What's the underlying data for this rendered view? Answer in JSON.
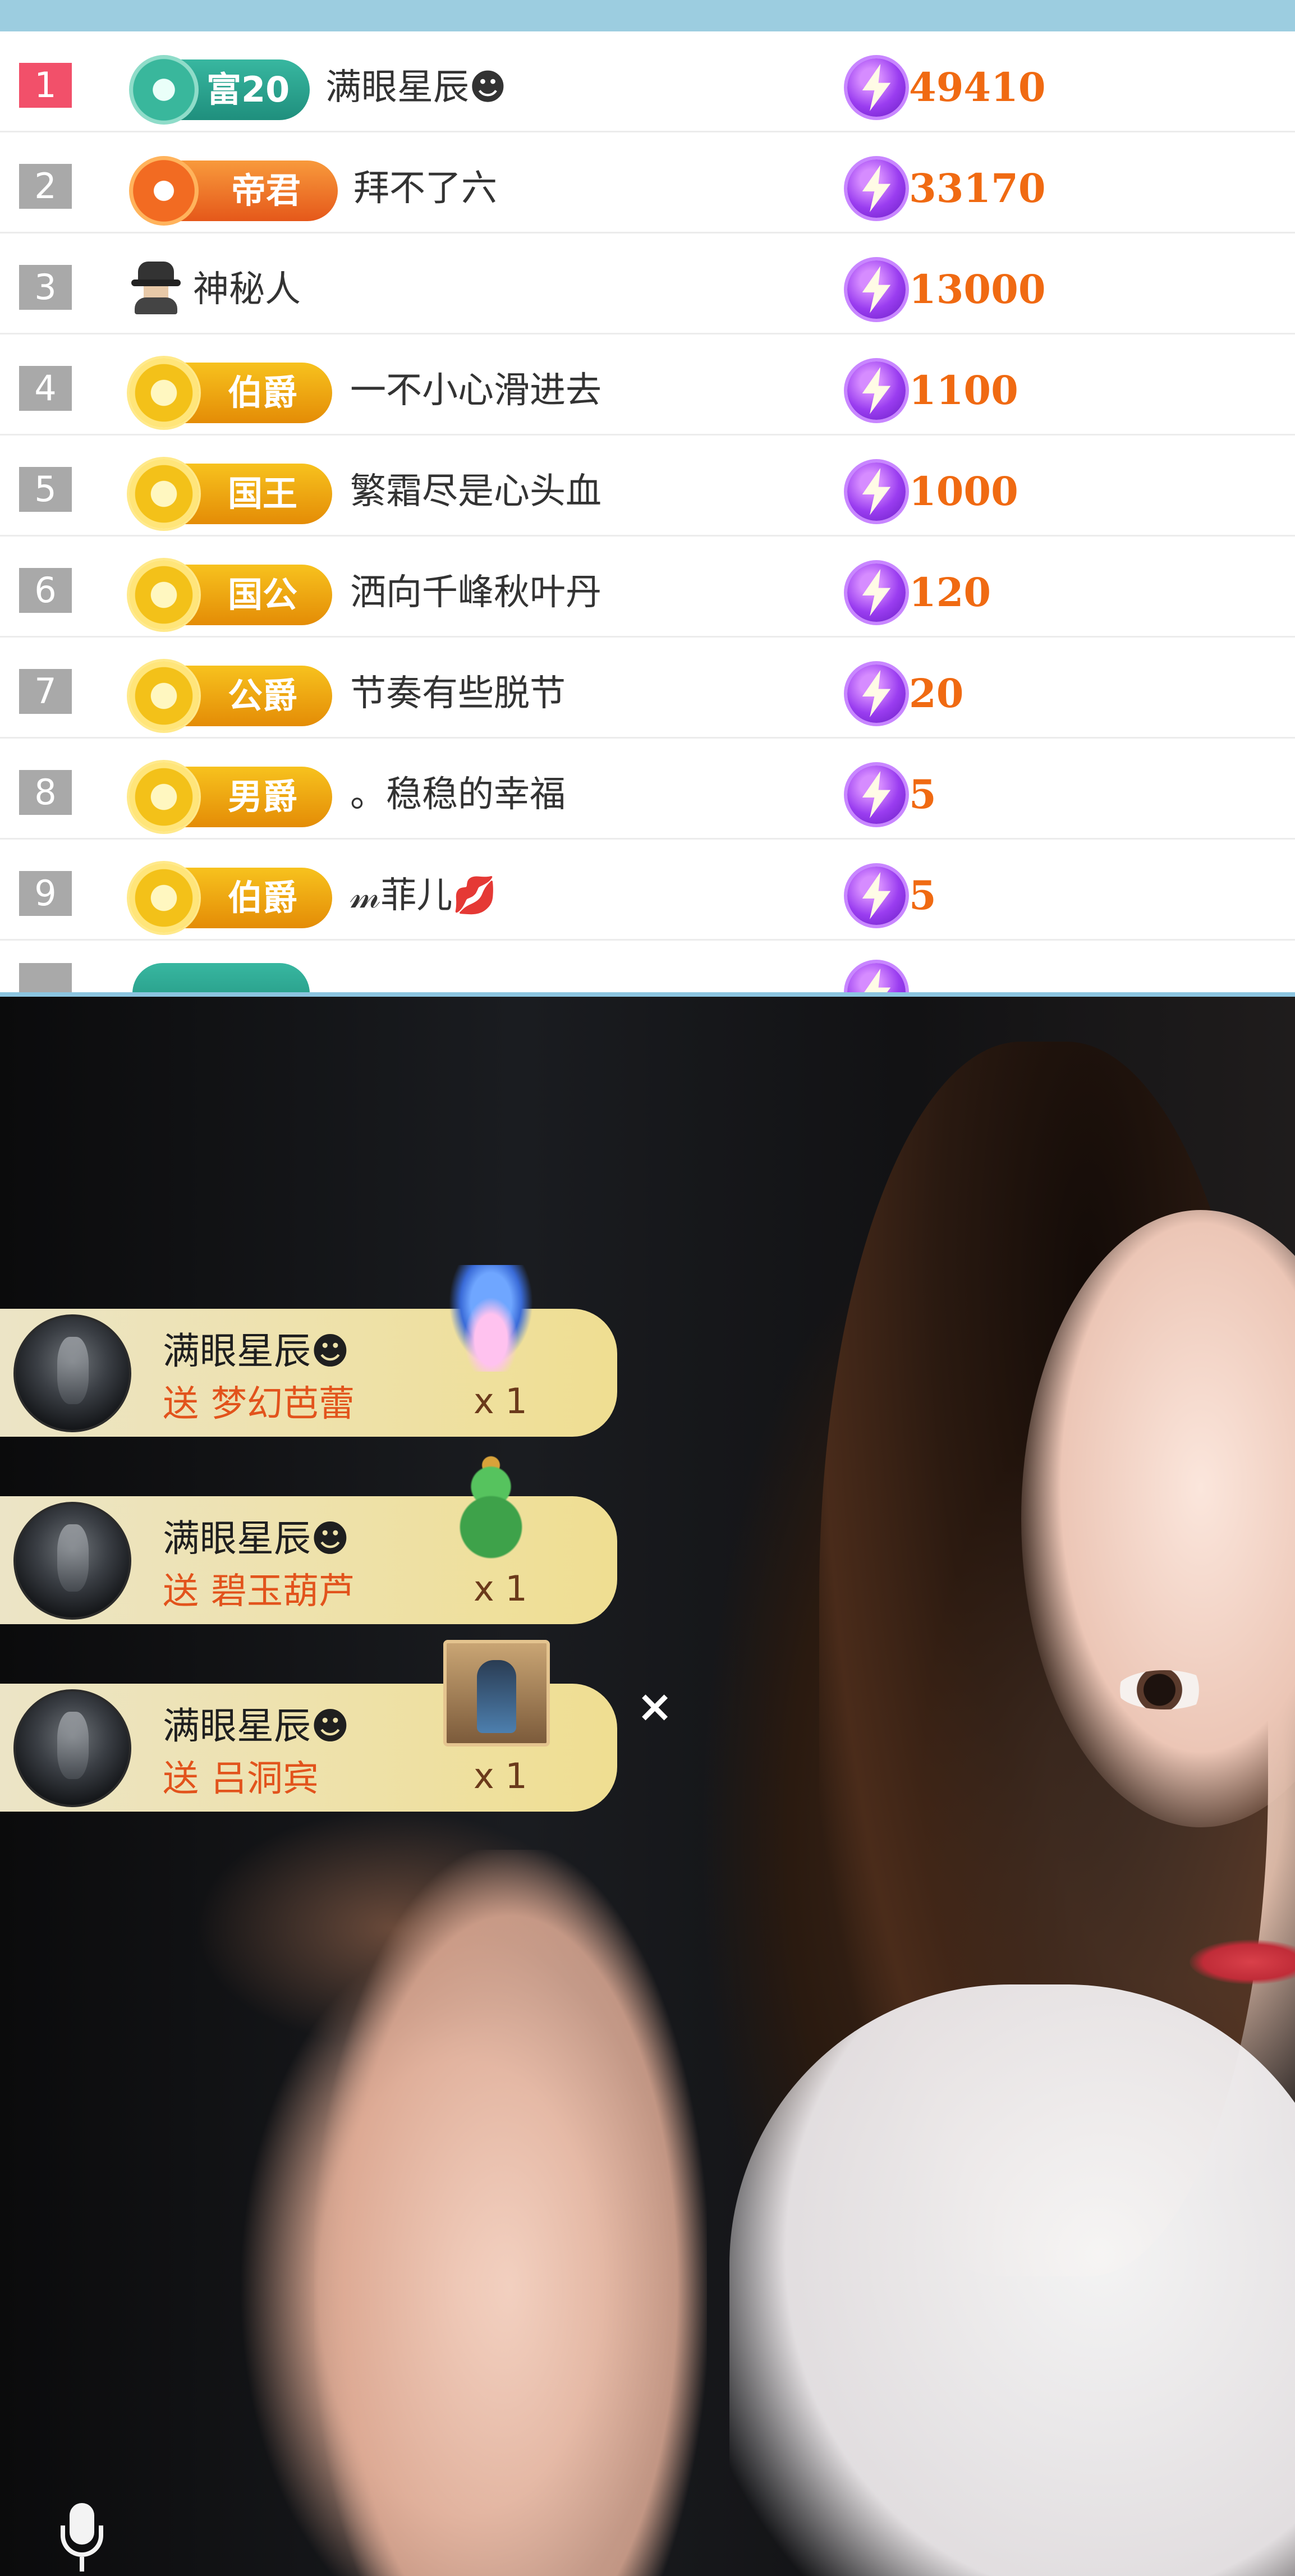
{
  "ranking": [
    {
      "rank": "1",
      "badge": "富20",
      "badge_style": "teal",
      "name": "满眼星辰☻",
      "value": "49410"
    },
    {
      "rank": "2",
      "badge": "帝君",
      "badge_style": "orange",
      "name": "拜不了六",
      "value": "33170"
    },
    {
      "rank": "3",
      "badge": "",
      "badge_style": "mystery",
      "name": "神秘人",
      "value": "13000"
    },
    {
      "rank": "4",
      "badge": "伯爵",
      "badge_style": "gold",
      "name": "一不小心滑进去",
      "value": "1100"
    },
    {
      "rank": "5",
      "badge": "国王",
      "badge_style": "gold",
      "name": "繁霜尽是心头血",
      "value": "1000"
    },
    {
      "rank": "6",
      "badge": "国公",
      "badge_style": "gold",
      "name": "洒向千峰秋叶丹",
      "value": "120"
    },
    {
      "rank": "7",
      "badge": "公爵",
      "badge_style": "gold",
      "name": "节奏有些脱节",
      "value": "20"
    },
    {
      "rank": "8",
      "badge": "男爵",
      "badge_style": "gold",
      "name": "。稳稳的幸福",
      "value": "5"
    },
    {
      "rank": "9",
      "badge": "伯爵",
      "badge_style": "gold",
      "name": "𝓂菲儿💋",
      "value": "5"
    }
  ],
  "gift_feed": [
    {
      "user": "满眼星辰☻",
      "verb": "送",
      "gift": "梦幻芭蕾",
      "count": "x 1",
      "gift_icon": "ballet-gift-icon"
    },
    {
      "user": "满眼星辰☻",
      "verb": "送",
      "gift": "碧玉葫芦",
      "count": "x 1",
      "gift_icon": "jade-gourd-gift-icon"
    },
    {
      "user": "满眼星辰☻",
      "verb": "送",
      "gift": "吕洞宾",
      "count": "x 1",
      "gift_icon": "lv-dongbin-gift-icon"
    }
  ],
  "controls": {
    "close_label": "×"
  },
  "colors": {
    "rank_first": "#f2506a",
    "rank_default": "#a9a9a9",
    "value_text": "#f06a12",
    "gift_verb_text": "#e2531c",
    "top_bar": "#9ccde0"
  }
}
